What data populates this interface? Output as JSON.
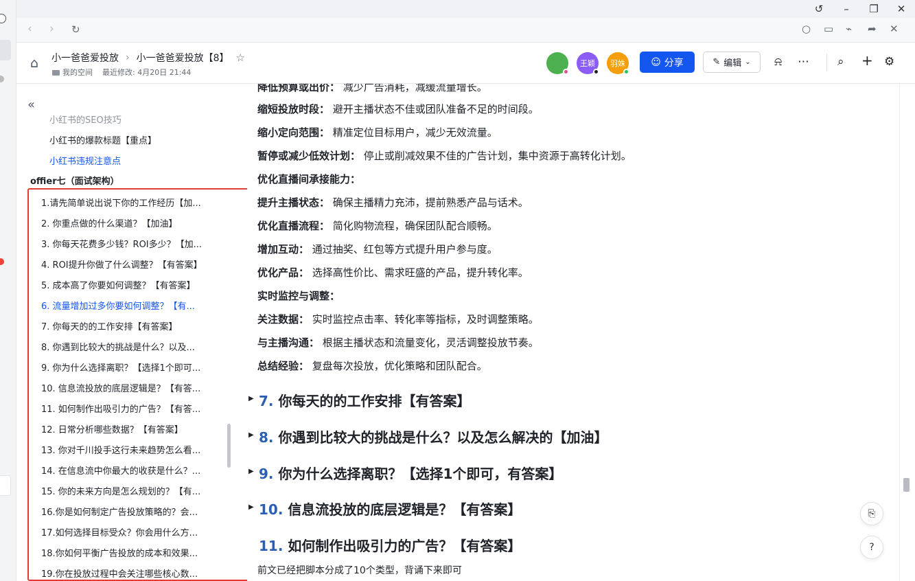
{
  "breadcrumb": {
    "parent": "小一爸爸爱投放",
    "current": "小一爸爸爱投放【8】"
  },
  "meta": {
    "space": "我的空间",
    "modified": "最近修改: 4月20日 21:44"
  },
  "avatars": [
    {
      "text": "",
      "color": "#4caf50",
      "status": "#e0508f"
    },
    {
      "text": "王颖",
      "color": "#8b5cf6",
      "status": "#1f2329"
    },
    {
      "text": "羽姝",
      "color": "#f59e0b",
      "status": "#22c55e"
    }
  ],
  "toolbar": {
    "share_label": "分享",
    "edit_label": "编辑"
  },
  "sidebar": {
    "items": [
      {
        "label": "小红书的SEO技巧",
        "active": false
      },
      {
        "label": "小红书的爆款标题【重点】",
        "active": false
      },
      {
        "label": "小红书违规注意点",
        "active": true
      }
    ],
    "group": "offier七（面试架构）",
    "toc": [
      {
        "label": "1.请先简单说出说下你的工作经历【加...",
        "active": false
      },
      {
        "label": "2. 你重点做的什么渠道？【加油】",
        "active": false
      },
      {
        "label": "3. 你每天花费多少钱？ROI多少？【加...",
        "active": false
      },
      {
        "label": "4. ROI提升你做了什么调整？【有答案】",
        "active": false
      },
      {
        "label": "5. 成本高了你要如何调整？【有答案】",
        "active": false
      },
      {
        "label": "6. 流量增加过多你要如何调整？【有...",
        "active": true
      },
      {
        "label": "7. 你每天的的工作安排【有答案】",
        "active": false
      },
      {
        "label": "8. 你遇到比较大的挑战是什么？以及...",
        "active": false
      },
      {
        "label": "9. 你为什么选择离职？【选择1个即可...",
        "active": false
      },
      {
        "label": "10. 信息流投放的底层逻辑是？【有答...",
        "active": false
      },
      {
        "label": "11. 如何制作出吸引力的广告？【有答...",
        "active": false
      },
      {
        "label": "12. 日常分析哪些数据？【有答案】",
        "active": false
      },
      {
        "label": "13. 你对千川投手这行未来趋势怎么看...",
        "active": false
      },
      {
        "label": "14. 在信息流中你最大的收获是什么？...",
        "active": false
      },
      {
        "label": "15. 你的未来方向是怎么规划的？【有...",
        "active": false
      },
      {
        "label": "16.你是如何制定广告投放策略的？会...",
        "active": false
      },
      {
        "label": "17.如何选择目标受众？你会用什么方...",
        "active": false
      },
      {
        "label": "18.你如何平衡广告投放的成本和效果...",
        "active": false
      },
      {
        "label": "19.你在投放过程中会关注哪些核心数...",
        "active": false
      }
    ]
  },
  "content": {
    "lines": [
      {
        "bold": "降低预算或出价：",
        "text": " 减少广告消耗，减缓流量增长。"
      },
      {
        "bold": "缩短投放时段：",
        "text": " 避开主播状态不佳或团队准备不足的时间段。"
      },
      {
        "bold": "缩小定向范围：",
        "text": " 精准定位目标用户，减少无效流量。"
      },
      {
        "bold": "暂停或减少低效计划：",
        "text": " 停止或削减效果不佳的广告计划，集中资源于高转化计划。"
      },
      {
        "bold": "优化直播间承接能力：",
        "text": ""
      },
      {
        "bold": "提升主播状态：",
        "text": " 确保主播精力充沛，提前熟悉产品与话术。"
      },
      {
        "bold": "优化直播流程：",
        "text": " 简化购物流程，确保团队配合顺畅。"
      },
      {
        "bold": "增加互动：",
        "text": " 通过抽奖、红包等方式提升用户参与度。"
      },
      {
        "bold": "优化产品：",
        "text": " 选择高性价比、需求旺盛的产品，提升转化率。"
      },
      {
        "bold": "实时监控与调整：",
        "text": ""
      },
      {
        "bold": "关注数据：",
        "text": " 实时监控点击率、转化率等指标，及时调整策略。"
      },
      {
        "bold": "与主播沟通：",
        "text": " 根据主播状态和流量变化，灵活调整投放节奏。"
      },
      {
        "bold": "总结经验：",
        "text": " 复盘每次投放，优化策略和团队配合。"
      }
    ],
    "headings": [
      {
        "num": "7.",
        "text": "你每天的的工作安排【有答案】",
        "collapsible": true
      },
      {
        "num": "8.",
        "text": "你遇到比较大的挑战是什么？以及怎么解决的【加油】",
        "collapsible": true
      },
      {
        "num": "9.",
        "text": "你为什么选择离职？【选择1个即可，有答案】",
        "collapsible": true
      },
      {
        "num": "10.",
        "text": "信息流投放的底层逻辑是？【有答案】",
        "collapsible": true
      },
      {
        "num": "11.",
        "text": "如何制作出吸引力的广告？【有答案】",
        "collapsible": false
      }
    ],
    "tail": "前文已经把脚本分成了10个类型，背诵下来即可"
  }
}
